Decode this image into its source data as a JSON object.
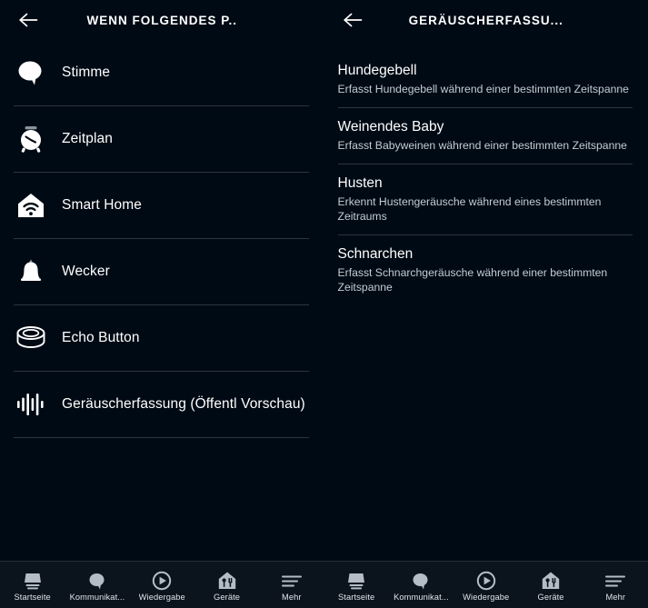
{
  "left_pane": {
    "header": {
      "back_icon": "arrow-left-icon",
      "title": "WENN FOLGENDES P.."
    },
    "items": [
      {
        "label": "Stimme",
        "icon": "speech-bubble-icon"
      },
      {
        "label": "Zeitplan",
        "icon": "alarm-clock-icon"
      },
      {
        "label": "Smart Home",
        "icon": "smart-home-icon"
      },
      {
        "label": "Wecker",
        "icon": "bell-icon"
      },
      {
        "label": "Echo Button",
        "icon": "echo-button-icon"
      },
      {
        "label": "Geräuscherfassung (Öffentl Vorschau)",
        "icon": "sound-wave-icon"
      }
    ]
  },
  "right_pane": {
    "header": {
      "back_icon": "arrow-left-icon",
      "title": "GERÄUSCHERFASSU..."
    },
    "items": [
      {
        "title": "Hundegebell",
        "description": "Erfasst Hundegebell während einer bestimmten Zeitspanne"
      },
      {
        "title": "Weinendes Baby",
        "description": "Erfasst Babyweinen während einer bestimmten Zeitspanne"
      },
      {
        "title": "Husten",
        "description": "Erkennt Hustengeräusche während eines bestimmten Zeitraums"
      },
      {
        "title": "Schnarchen",
        "description": "Erfasst Schnarchgeräusche während einer bestimmten Zeitspanne"
      }
    ]
  },
  "bottom_nav": {
    "items": [
      {
        "label": "Startseite",
        "icon": "echo-show-icon"
      },
      {
        "label": "Kommunikat...",
        "icon": "speech-bubble-icon"
      },
      {
        "label": "Wiedergabe",
        "icon": "play-circle-icon"
      },
      {
        "label": "Geräte",
        "icon": "devices-home-icon"
      },
      {
        "label": "Mehr",
        "icon": "hamburger-menu-icon"
      }
    ]
  },
  "colors": {
    "background": "#000a14",
    "navbar_background": "#0b131d",
    "divider": "#2b3542",
    "text_primary": "#ffffff",
    "text_secondary": "#c4ccd4",
    "nav_icon": "#b4bcc5"
  }
}
